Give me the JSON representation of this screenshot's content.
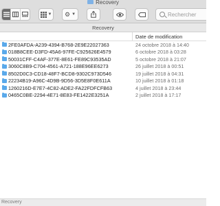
{
  "window": {
    "title": "Recovery"
  },
  "toolbar": {
    "view_icons": [
      "list-view-icon",
      "column-view-icon",
      "grid-view-icon",
      "gear-icon",
      "share-icon",
      "tag-icon"
    ],
    "search_placeholder": "Rechercher"
  },
  "pathbar": {
    "label": "Recovery"
  },
  "columns": {
    "name": "",
    "date": "Date de modification"
  },
  "files": [
    {
      "name": "2FE0AFDA-A239-4394-B768-2E9E22027363",
      "date": "24 octobre 2018 à 14:40"
    },
    {
      "name": "018B8CEE-D3FD-45A6-97FE-C925626E4579",
      "date": "6 octobre 2018 à 03:28"
    },
    {
      "name": "50031CFF-C4AF-377E-8E61-FE89C93535AD",
      "date": "5 octobre 2018 à 21:07"
    },
    {
      "name": "3060C8B9-C704-4561-A721-188E96EE6273",
      "date": "26 juillet 2018 à 00:51"
    },
    {
      "name": "8502D0C3-CD18-48F7-BCD8-9302C973D546",
      "date": "19 juillet 2018 à 04:31"
    },
    {
      "name": "22234B19-A96C-4D9B-9D56-3D5E8F0E611A",
      "date": "10 juillet 2018 à 01:18"
    },
    {
      "name": "1260216D-E7E7-4C82-ADE2-FA22FDFCFB63",
      "date": "4 juillet 2018 à 23:44"
    },
    {
      "name": "0465C0BE-2294-4E71-8E83-FE1422E3251A",
      "date": "2 juillet 2018 à 17:17"
    }
  ],
  "statusbar": {
    "label": "Recovery"
  }
}
